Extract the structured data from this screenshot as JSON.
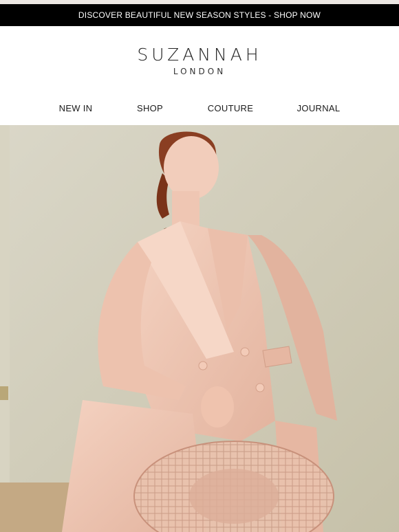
{
  "promo": {
    "text": "DISCOVER BEAUTIFUL NEW SEASON STYLES - SHOP NOW"
  },
  "brand": {
    "name": "SUZANNAH",
    "sub": "LONDON"
  },
  "nav": {
    "items": [
      {
        "label": "NEW IN"
      },
      {
        "label": "SHOP"
      },
      {
        "label": "COUTURE"
      },
      {
        "label": "JOURNAL"
      }
    ]
  },
  "hero": {
    "description_icon": "fashion-photo",
    "colors": {
      "background": "#cfcbb7",
      "suit": "#f0c9b6",
      "suit_shadow": "#dcae99",
      "hair": "#8a3e22",
      "skin": "#f2cdbb"
    }
  }
}
